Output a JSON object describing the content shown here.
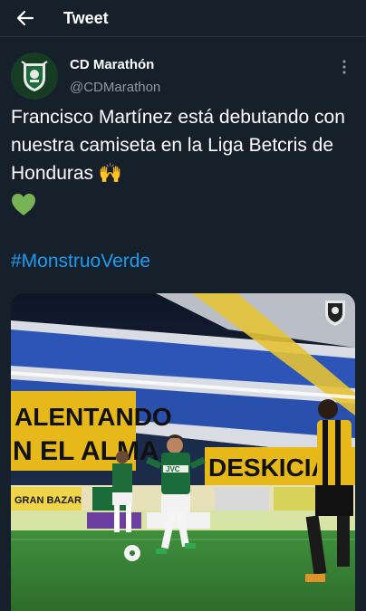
{
  "header": {
    "title": "Tweet",
    "back_icon": "arrow-left-icon"
  },
  "tweet": {
    "author_name": "CD Marathón",
    "author_handle": "@CDMarathon",
    "text": "Francisco Martínez está debutando con nuestra camiseta en la Liga Betcris de Honduras",
    "emoji_raised_hands": "🙌",
    "emoji_heart": "💚",
    "hashtag": "#MonstruoVerde",
    "more_icon": "vertical-dots-icon"
  },
  "media": {
    "banner_left_line1": "ALENTANDO",
    "banner_left_line2": "N EL ALMA",
    "banner_right": "DESKICIA",
    "ad_left": "GRAN BAZAR",
    "player_sponsor": "JVC",
    "brand_color_green": "#1c6b3a",
    "accent_yellow": "#e7b81a"
  }
}
